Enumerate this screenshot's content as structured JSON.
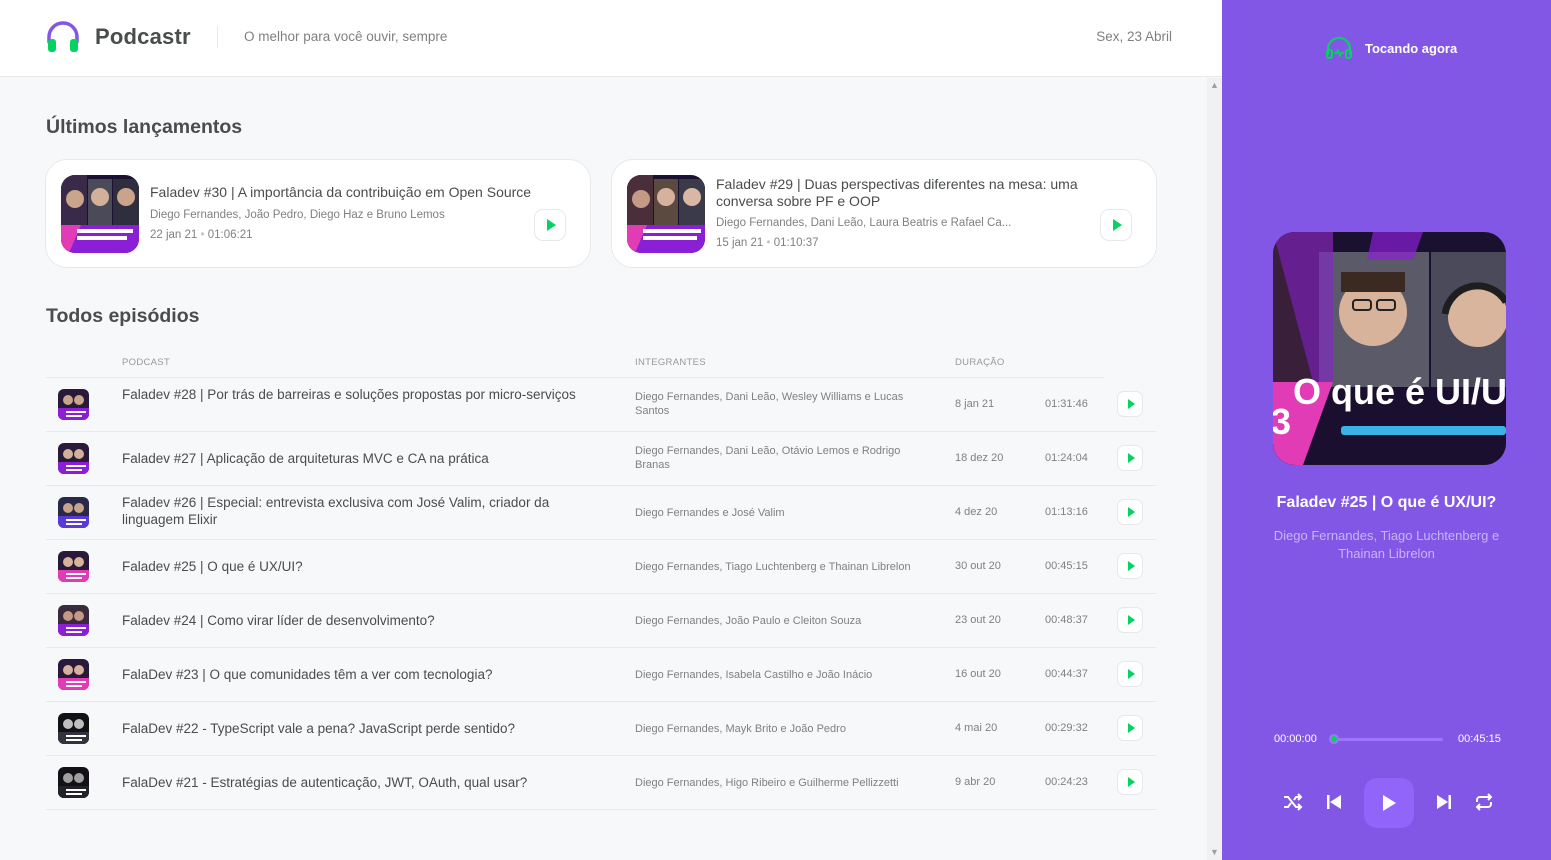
{
  "header": {
    "app_name": "Podcastr",
    "tagline": "O melhor para você ouvir, sempre",
    "date": "Sex, 23 Abril"
  },
  "latest": {
    "title": "Últimos lançamentos",
    "cards": [
      {
        "title": "Faladev #30 | A importância da contribuição em Open Source",
        "members": "Diego Fernandes, João Pedro, Diego Haz e Bruno Lemos",
        "date": "22 jan 21",
        "duration": "01:06:21"
      },
      {
        "title": "Faladev #29 | Duas perspectivas diferentes na mesa: uma conversa sobre PF e OOP",
        "members": "Diego Fernandes, Dani Leão, Laura Beatris e Rafael Ca...",
        "date": "15 jan 21",
        "duration": "01:10:37"
      }
    ]
  },
  "all": {
    "title": "Todos episódios",
    "columns": [
      "PODCAST",
      "INTEGRANTES",
      "DURAÇÃO"
    ],
    "rows": [
      {
        "title": "Faladev #28 | Por trás de barreiras e soluções propostas por micro-serviços",
        "members": "Diego Fernandes, Dani Leão, Wesley Williams e Lucas Santos",
        "date": "8 jan 21",
        "duration": "01:31:46"
      },
      {
        "title": "Faladev #27 | Aplicação de arquiteturas MVC e CA na prática",
        "members": "Diego Fernandes, Dani Leão, Otávio Lemos e Rodrigo Branas",
        "date": "18 dez 20",
        "duration": "01:24:04"
      },
      {
        "title": "Faladev #26 | Especial: entrevista exclusiva com José Valim, criador da linguagem Elixir",
        "members": "Diego Fernandes e José Valim",
        "date": "4 dez 20",
        "duration": "01:13:16"
      },
      {
        "title": "Faladev #25 | O que é UX/UI?",
        "members": "Diego Fernandes, Tiago Luchtenberg e Thainan Librelon",
        "date": "30 out 20",
        "duration": "00:45:15"
      },
      {
        "title": "Faladev #24 | Como virar líder de desenvolvimento?",
        "members": "Diego Fernandes, João Paulo e Cleiton Souza",
        "date": "23 out 20",
        "duration": "00:48:37"
      },
      {
        "title": "FalaDev #23 | O que comunidades têm a ver com tecnologia?",
        "members": "Diego Fernandes, Isabela Castilho e João Inácio",
        "date": "16 out 20",
        "duration": "00:44:37"
      },
      {
        "title": "FalaDev #22 - TypeScript vale a pena? JavaScript perde sentido?",
        "members": "Diego Fernandes, Mayk Brito e João Pedro",
        "date": "4 mai 20",
        "duration": "00:29:32"
      },
      {
        "title": "FalaDev #21 - Estratégias de autenticação, JWT, OAuth, qual usar?",
        "members": "Diego Fernandes, Higo Ribeiro e Guilherme Pellizzetti",
        "date": "9 abr 20",
        "duration": "00:24:23"
      }
    ]
  },
  "player": {
    "label": "Tocando agora",
    "title": "Faladev #25 | O que é UX/UI?",
    "members": "Diego Fernandes, Tiago Luchtenberg e Thainan Librelon",
    "cover_text": "O que é UI/U",
    "current_time": "00:00:00",
    "total_time": "00:45:15",
    "progress": 0
  },
  "colors": {
    "accent": "#8257e5",
    "green": "#04d361",
    "text": "#494d4b",
    "muted": "#808080"
  }
}
